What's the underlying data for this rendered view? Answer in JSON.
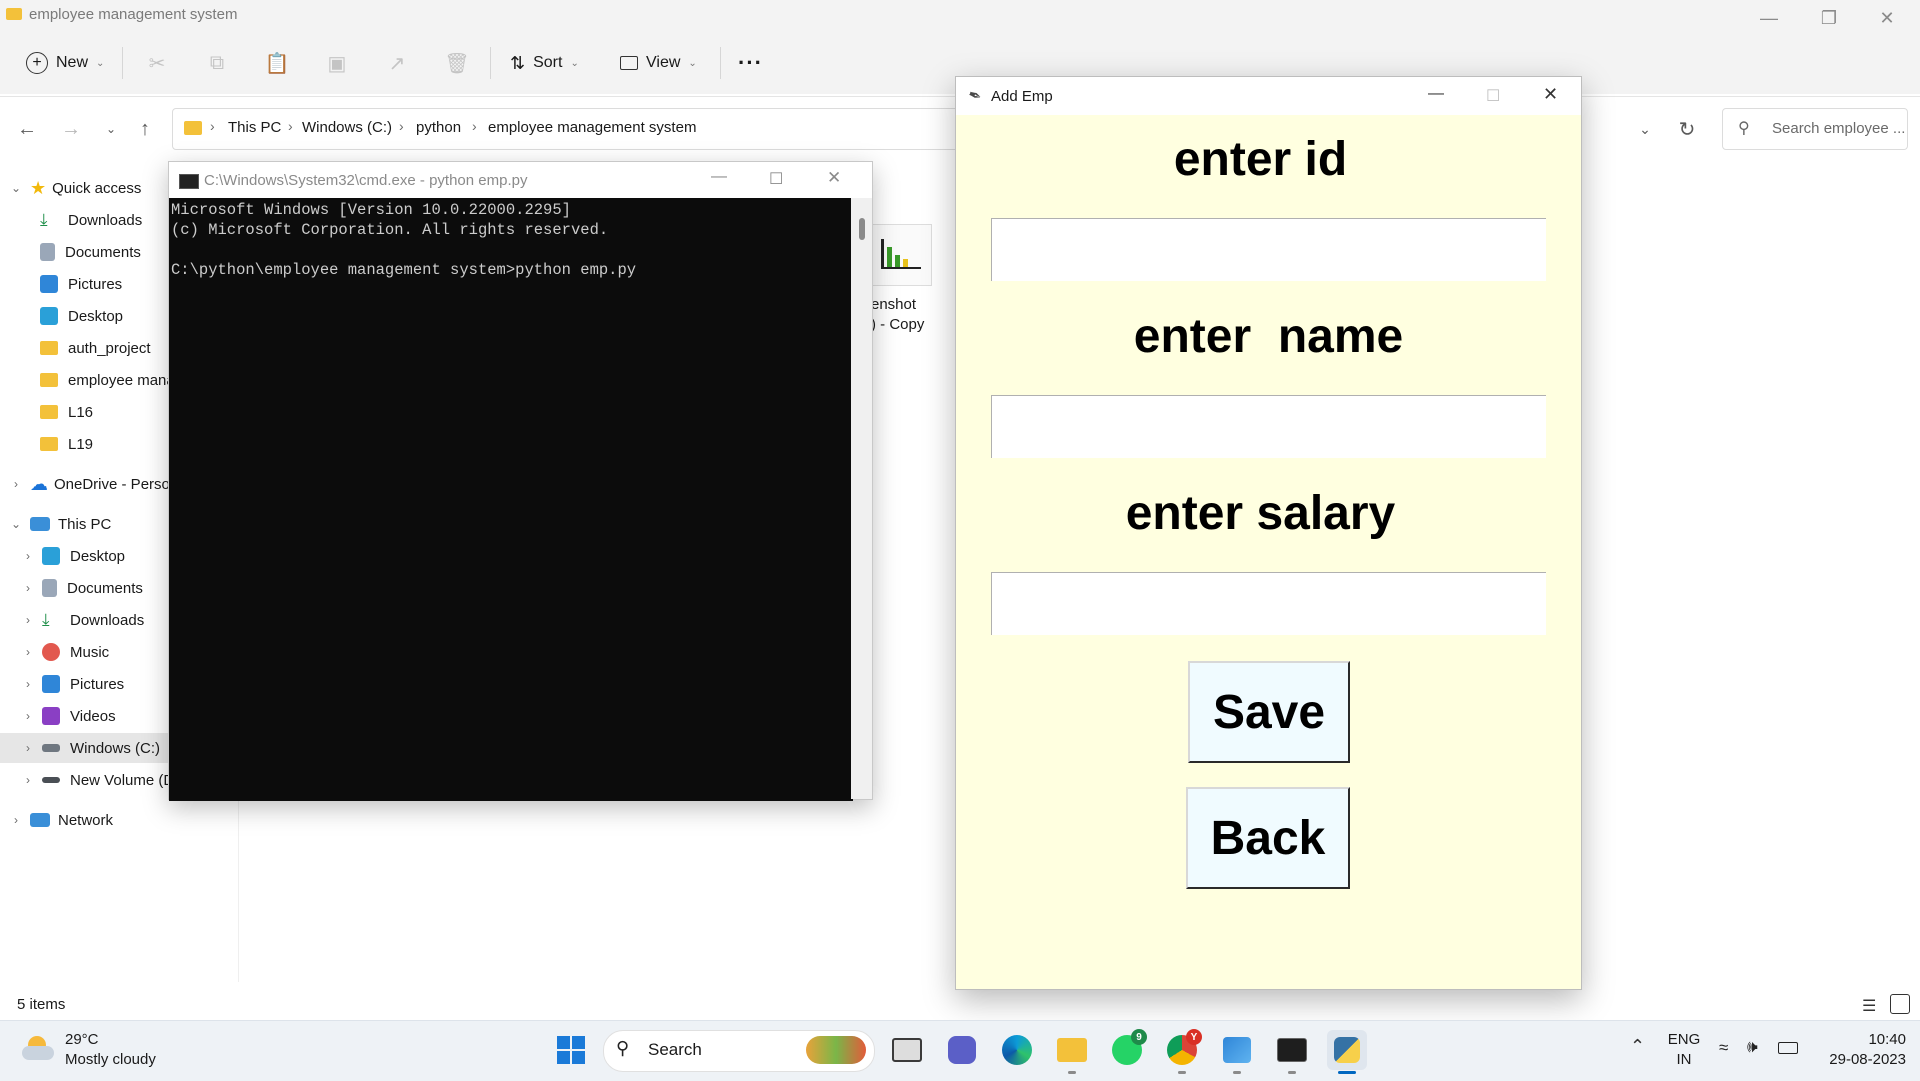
{
  "explorer": {
    "title": "employee management system",
    "toolbar": {
      "new_label": "New",
      "sort_label": "Sort",
      "view_label": "View",
      "more_label": "···"
    },
    "breadcrumb": [
      "This PC",
      "Windows (C:)",
      "python",
      "employee management system"
    ],
    "search_placeholder": "Search employee ...",
    "sidebar": {
      "quick_access": "Quick access",
      "quick_items": [
        "Downloads",
        "Documents",
        "Pictures",
        "Desktop",
        "auth_project",
        "employee mana",
        "L16",
        "L19"
      ],
      "onedrive": "OneDrive - Perso",
      "this_pc": "This PC",
      "pc_items": [
        "Desktop",
        "Documents",
        "Downloads",
        "Music",
        "Pictures",
        "Videos",
        "Windows (C:)",
        "New Volume (D"
      ],
      "network": "Network"
    },
    "file_label_line1": "enshot",
    "file_label_line2": ") - Copy",
    "status": "5 items"
  },
  "cmd": {
    "title": "C:\\Windows\\System32\\cmd.exe - python  emp.py",
    "lines": [
      "Microsoft Windows [Version 10.0.22000.2295]",
      "(c) Microsoft Corporation. All rights reserved.",
      "",
      "C:\\python\\employee management system>python emp.py"
    ]
  },
  "addemp": {
    "title": "Add Emp",
    "label_id": "enter id",
    "label_name": "enter  name",
    "label_salary": "enter salary",
    "value_id": "",
    "value_name": "",
    "value_salary": "",
    "save_label": "Save",
    "back_label": "Back"
  },
  "taskbar": {
    "weather_temp": "29°C",
    "weather_desc": "Mostly cloudy",
    "search_label": "Search",
    "whatsapp_badge": "9",
    "chrome_badge": "Y",
    "lang_line1": "ENG",
    "lang_line2": "IN",
    "time": "10:40",
    "date": "29-08-2023"
  },
  "colors": {
    "addemp_bg": "#ffffe0",
    "button_bg": "#f0fbff",
    "cmd_bg": "#0c0c0c",
    "taskbar_bg": "#eef2f6",
    "folder": "#f3c13a",
    "accent": "#0078d4"
  }
}
